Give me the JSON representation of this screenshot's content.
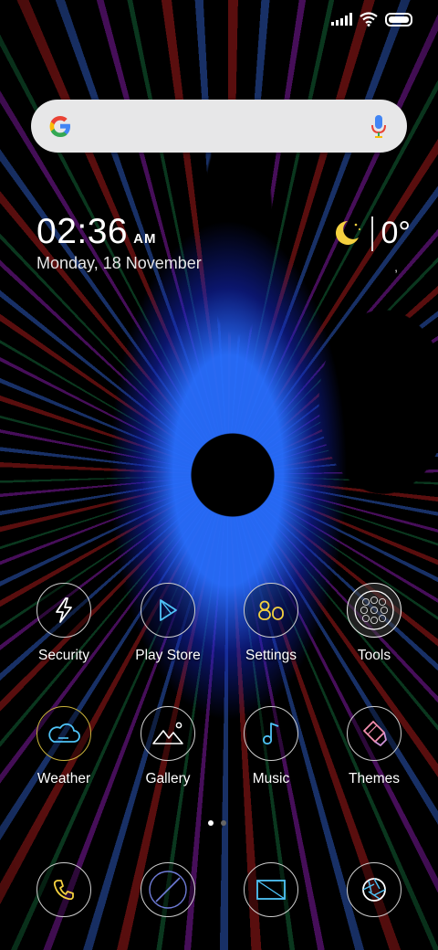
{
  "status_bar": {
    "signal_icon": "cell-signal-icon",
    "wifi_icon": "wifi-icon",
    "battery_icon": "battery-icon"
  },
  "search": {
    "logo": "google-g-icon",
    "mic": "mic-icon"
  },
  "clock": {
    "time": "02:36",
    "ampm": "AM",
    "date": "Monday, 18 November"
  },
  "weather_widget": {
    "icon": "moon-cloud-icon",
    "temperature": "0°",
    "extra": ","
  },
  "apps_row1": [
    {
      "label": "Security",
      "icon": "lightning-shield-icon"
    },
    {
      "label": "Play Store",
      "icon": "play-store-icon"
    },
    {
      "label": "Settings",
      "icon": "settings-icon"
    },
    {
      "label": "Tools",
      "icon": "tools-folder-icon"
    }
  ],
  "apps_row2": [
    {
      "label": "Weather",
      "icon": "cloud-icon"
    },
    {
      "label": "Gallery",
      "icon": "mountain-photo-icon"
    },
    {
      "label": "Music",
      "icon": "music-note-icon"
    },
    {
      "label": "Themes",
      "icon": "brush-icon"
    }
  ],
  "page_indicator": {
    "count": 2,
    "active": 1
  },
  "dock": [
    {
      "icon": "phone-icon"
    },
    {
      "icon": "browser-icon"
    },
    {
      "icon": "messages-icon"
    },
    {
      "icon": "camera-icon"
    }
  ],
  "colors": {
    "accent_yellow": "#f4d03f",
    "accent_cyan": "#4fc3f7",
    "search_bg": "#e7e7e8"
  }
}
